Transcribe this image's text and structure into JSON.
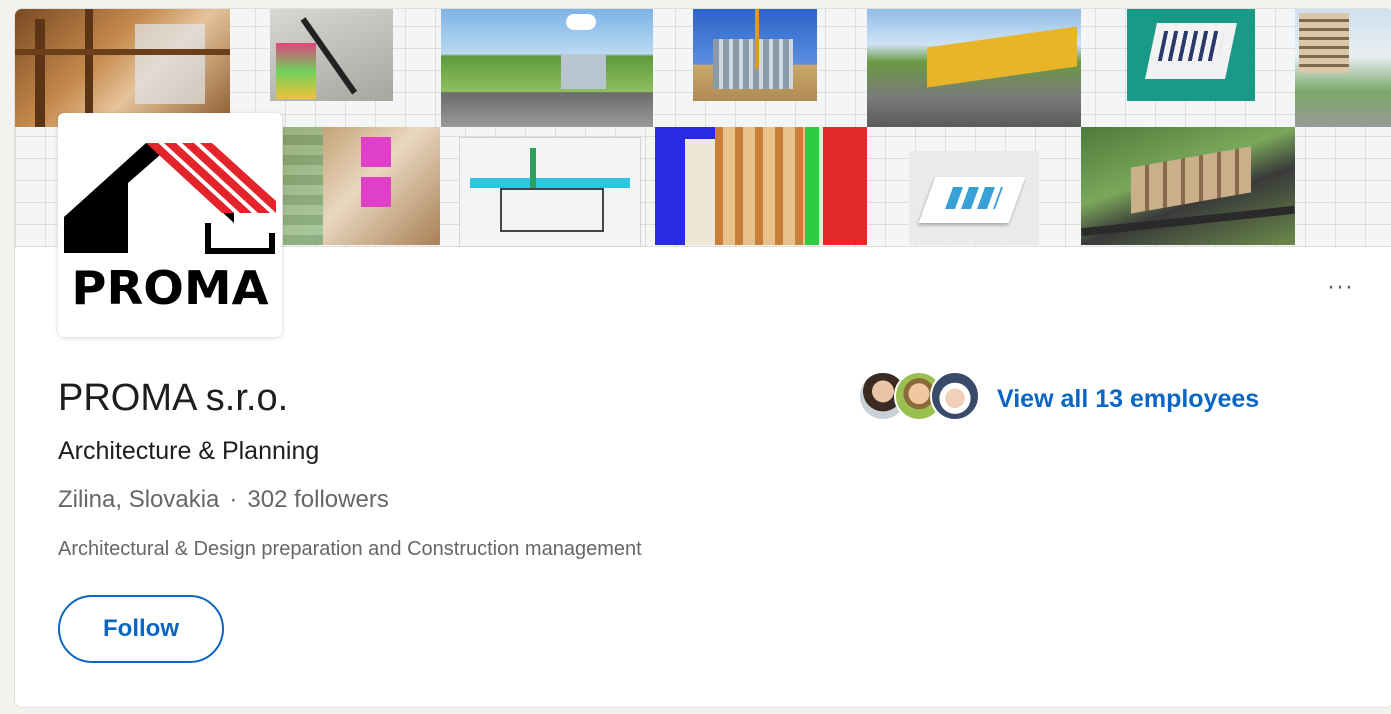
{
  "company": {
    "logo_text": "PROMA",
    "name": "PROMA s.r.o.",
    "industry": "Architecture & Planning",
    "location": "Zilina, Slovakia",
    "separator": "·",
    "followers": "302 followers",
    "tagline": "Architectural & Design preparation and Construction management"
  },
  "actions": {
    "follow_label": "Follow",
    "more_label": "···"
  },
  "employees": {
    "link_text": "View all 13 employees"
  },
  "colors": {
    "brand_blue": "#0a66c2",
    "logo_red": "#e3242b",
    "logo_black": "#000000"
  }
}
